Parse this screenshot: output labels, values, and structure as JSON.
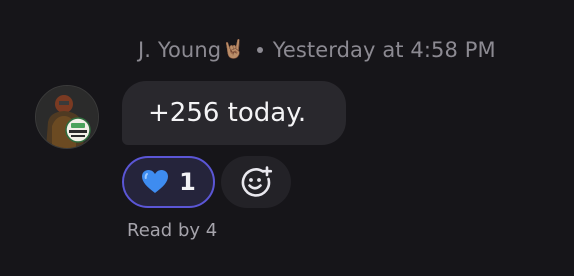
{
  "message": {
    "author": "J. Young",
    "author_emoji": "🤘🏽",
    "timestamp": "Yesterday at 4:58 PM",
    "text": "+256 today.",
    "reactions": [
      {
        "emoji": "💙",
        "emoji_name": "blue-heart-icon",
        "count": "1",
        "selected": true
      }
    ],
    "add_reaction_icon": "add-reaction-smiley-icon",
    "read_receipt": "Read by 4"
  },
  "colors": {
    "background": "#161519",
    "bubble": "#29282d",
    "meta_text": "#8c8a92",
    "reaction_border": "#5b56d6",
    "reaction_fill": "#25243b",
    "heart": "#3e8cf0"
  }
}
